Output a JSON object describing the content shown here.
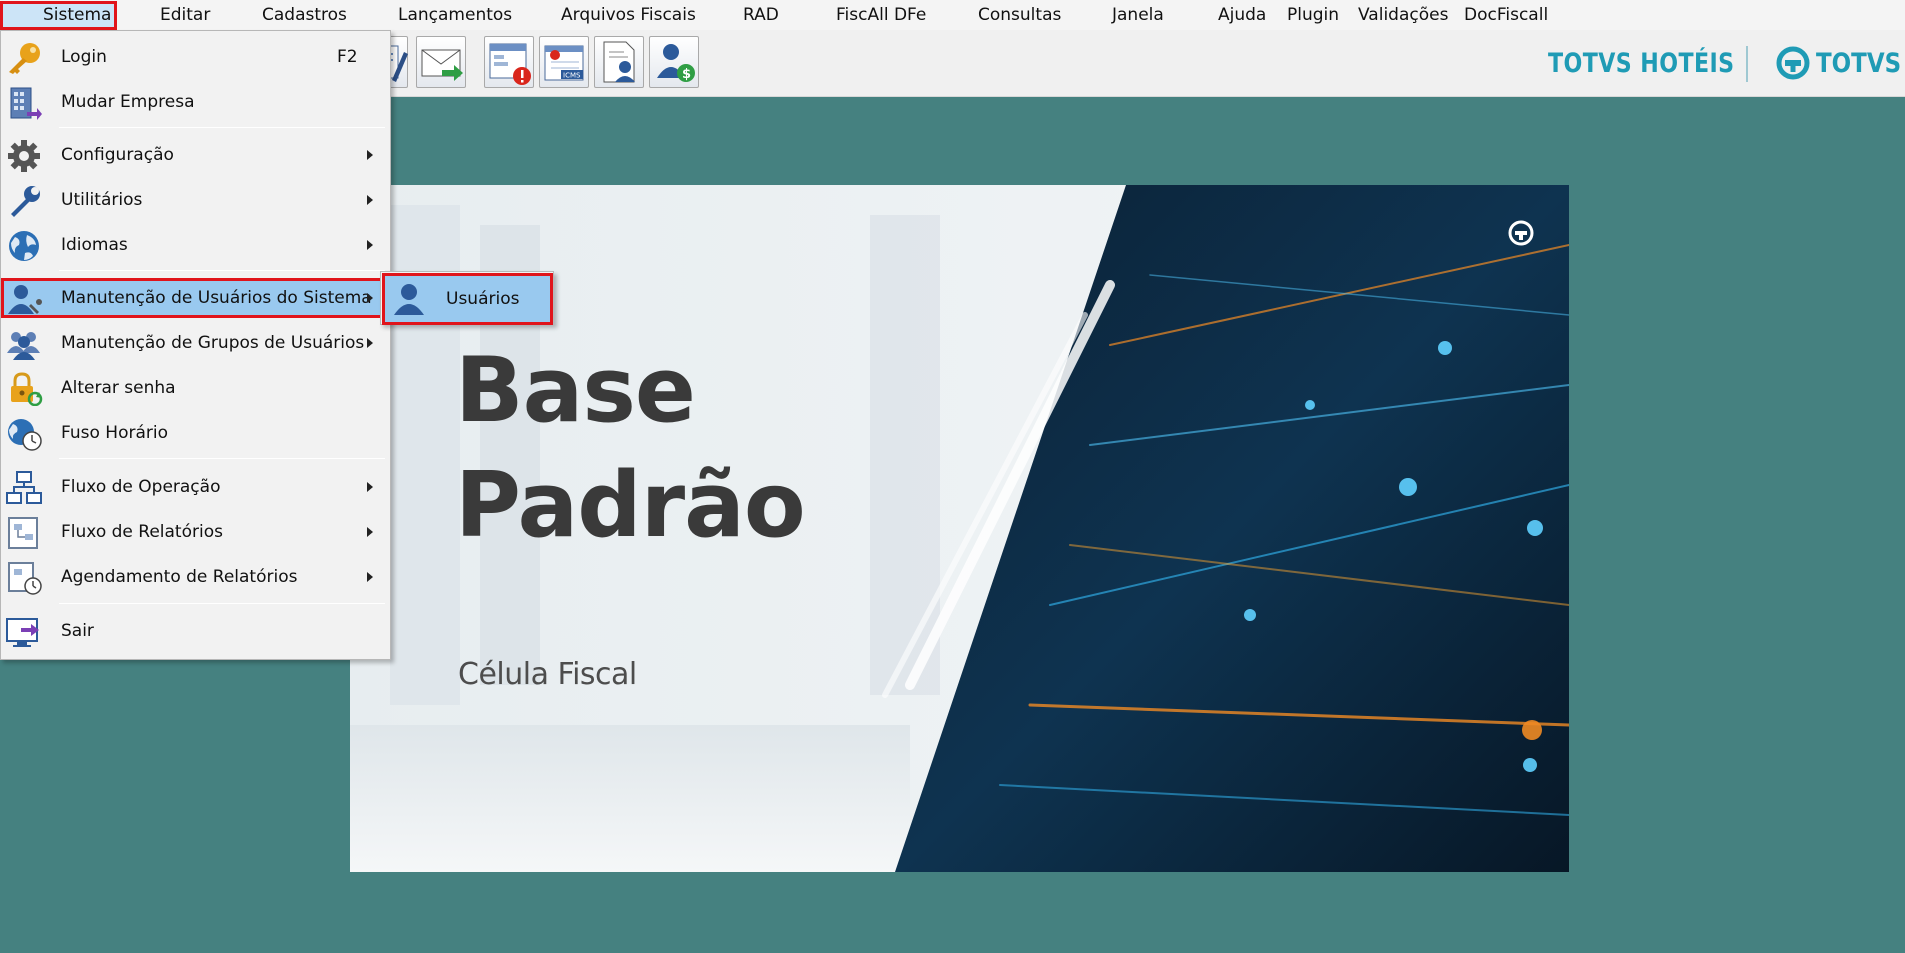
{
  "menubar": {
    "items": [
      {
        "label": "Sistema",
        "active": true
      },
      {
        "label": "Editar"
      },
      {
        "label": "Cadastros"
      },
      {
        "label": "Lançamentos"
      },
      {
        "label": "Arquivos Fiscais"
      },
      {
        "label": "RAD"
      },
      {
        "label": "FiscAll DFe"
      },
      {
        "label": "Consultas"
      },
      {
        "label": "Janela"
      },
      {
        "label": "Ajuda"
      },
      {
        "label": "Plugin"
      },
      {
        "label": "Validações"
      },
      {
        "label": "DocFiscall"
      }
    ]
  },
  "toolbar": {
    "buttons": [
      {
        "icon": "edit-document-icon"
      },
      {
        "icon": "send-mail-icon"
      },
      {
        "icon": "alert-window-icon"
      },
      {
        "icon": "icms-calendar-icon"
      },
      {
        "icon": "user-document-icon"
      },
      {
        "icon": "user-money-icon"
      }
    ]
  },
  "brand": {
    "product": "TOTVS HOTÉIS",
    "company": "TOTVS",
    "color": "#1f9bb5"
  },
  "splash": {
    "title_line1": "Base",
    "title_line2": "Padrão",
    "subtitle": "Célula Fiscal"
  },
  "sistema_menu": {
    "items": [
      {
        "label": "Login",
        "shortcut": "F2",
        "icon": "key-icon"
      },
      {
        "label": "Mudar Empresa",
        "icon": "building-icon"
      },
      {
        "label": "Configuração",
        "icon": "gear-icon",
        "submenu": true
      },
      {
        "label": "Utilitários",
        "icon": "wrench-icon",
        "submenu": true
      },
      {
        "label": "Idiomas",
        "icon": "globe-icon",
        "submenu": true
      },
      {
        "label": "Manutenção de Usuários do Sistema",
        "icon": "user-tools-icon",
        "submenu": true,
        "highlighted": true
      },
      {
        "label": "Manutenção de Grupos de Usuários",
        "icon": "user-group-icon",
        "submenu": true
      },
      {
        "label": "Alterar senha",
        "icon": "lock-refresh-icon"
      },
      {
        "label": "Fuso Horário",
        "icon": "globe-clock-icon"
      },
      {
        "label": "Fluxo de Operação",
        "icon": "flowchart-icon",
        "submenu": true
      },
      {
        "label": "Fluxo de Relatórios",
        "icon": "report-flow-icon",
        "submenu": true
      },
      {
        "label": "Agendamento de Relatórios",
        "icon": "report-schedule-icon",
        "submenu": true
      },
      {
        "label": "Sair",
        "icon": "exit-monitor-icon"
      }
    ]
  },
  "usuarios_submenu": {
    "items": [
      {
        "label": "Usuários",
        "icon": "user-icon",
        "highlighted": true
      }
    ]
  },
  "colors": {
    "desktop": "#458180",
    "highlight": "#99c9ef",
    "annotation_border": "#e0141b"
  }
}
